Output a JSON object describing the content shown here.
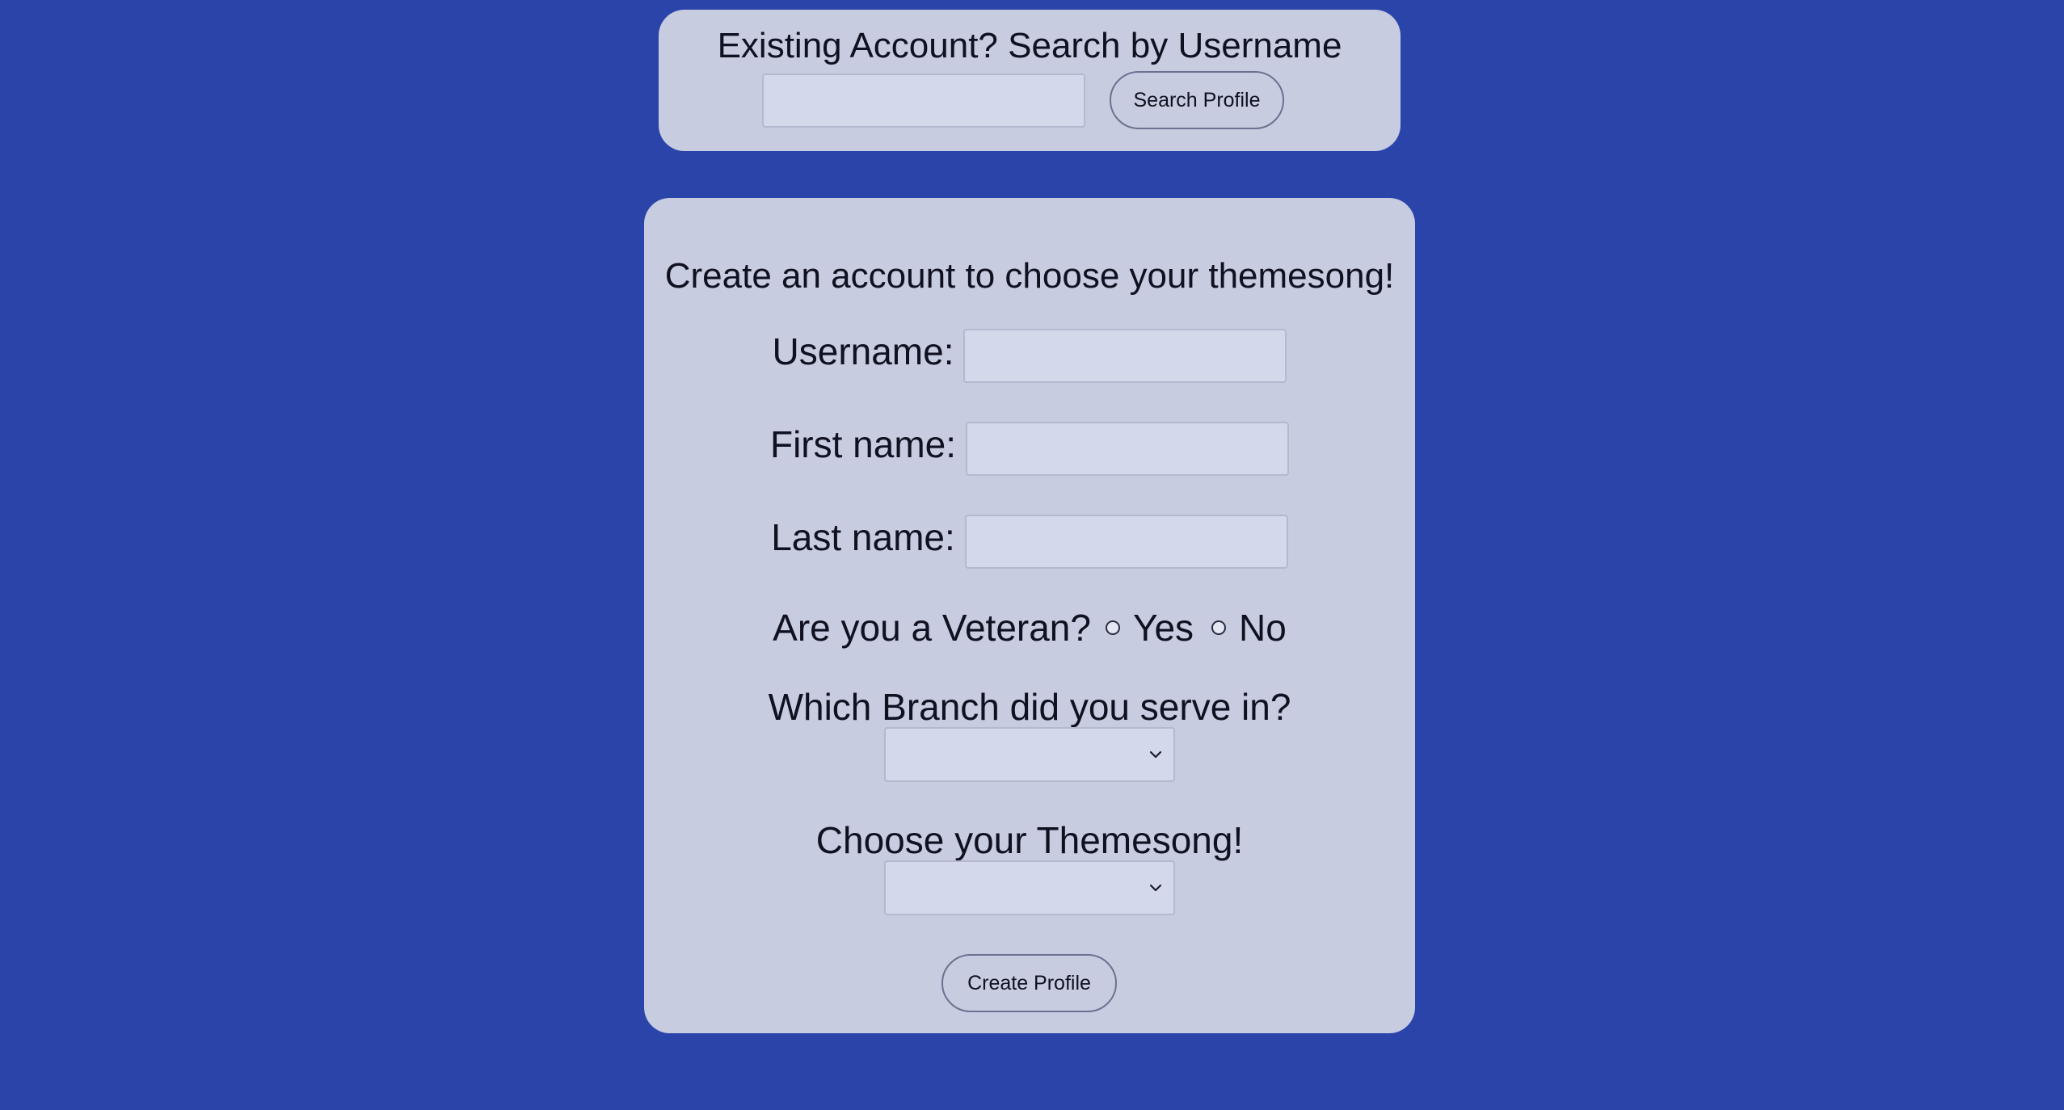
{
  "search": {
    "title": "Existing Account? Search by Username",
    "input_value": "",
    "input_placeholder": "",
    "button_label": "Search Profile"
  },
  "create": {
    "title": "Create an account to choose your themesong!",
    "username_label": "Username:",
    "username_value": "",
    "firstname_label": "First name:",
    "firstname_value": "",
    "lastname_label": "Last name:",
    "lastname_value": "",
    "veteran_question": "Are you a Veteran?",
    "veteran_yes": "Yes",
    "veteran_no": "No",
    "branch_label": "Which Branch did you serve in?",
    "branch_selected": "",
    "themesong_label": "Choose your Themesong!",
    "themesong_selected": "",
    "button_label": "Create Profile"
  },
  "colors": {
    "background": "#2b44aa",
    "card": "#c8cce0",
    "input": "#d3d8eb"
  },
  "icons": {
    "select_chevron": "chevron-down-icon",
    "radio": "radio-unchecked-icon"
  }
}
